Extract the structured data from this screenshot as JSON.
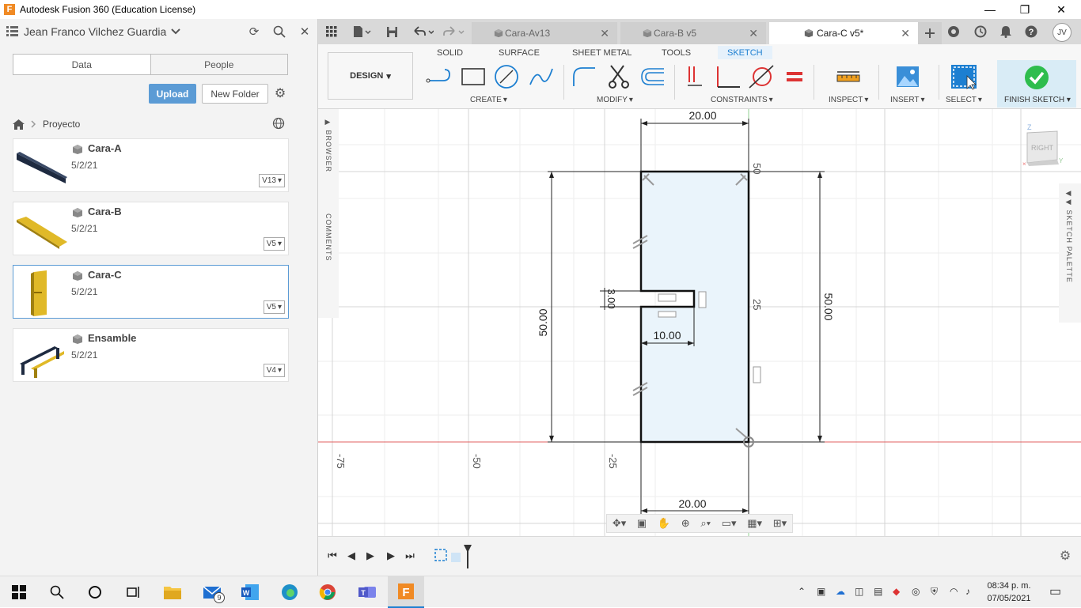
{
  "window": {
    "title": "Autodesk Fusion 360 (Education License)",
    "logo": "F",
    "min": "—",
    "max": "❐",
    "close": "✕"
  },
  "panel": {
    "user": "Jean Franco Vilchez Guardia",
    "tabs": [
      "Data",
      "People"
    ],
    "upload": "Upload",
    "new_folder": "New Folder",
    "breadcrumb": "Proyecto",
    "files": [
      {
        "name": "Cara-A",
        "date": "5/2/21",
        "version": "V13"
      },
      {
        "name": "Cara-B",
        "date": "5/2/21",
        "version": "V5"
      },
      {
        "name": "Cara-C",
        "date": "5/2/21",
        "version": "V5"
      },
      {
        "name": "Ensamble",
        "date": "5/2/21",
        "version": "V4"
      }
    ]
  },
  "tabs": {
    "docs": [
      {
        "label": "Cara-Av13"
      },
      {
        "label": "Cara-B v5"
      },
      {
        "label": "Cara-C v5*"
      }
    ],
    "user_initials": "JV"
  },
  "toolbar": {
    "design": "DESIGN",
    "workspaces": [
      "SOLID",
      "SURFACE",
      "SHEET METAL",
      "TOOLS",
      "SKETCH"
    ],
    "groups": [
      "CREATE",
      "MODIFY",
      "CONSTRAINTS",
      "INSPECT",
      "INSERT",
      "SELECT",
      "FINISH SKETCH"
    ]
  },
  "canvas": {
    "browser": "BROWSER",
    "comments": "COMMENTS",
    "palette": "SKETCH PALETTE",
    "viewcube": "RIGHT",
    "axis_z": "Z",
    "axis_y": "Y",
    "dims": {
      "top": "20.00",
      "bottom": "20.00",
      "left": "50.00",
      "right": "50.00",
      "slot_h": "3.00",
      "slot_w": "10.00"
    },
    "grid_labels": {
      "a": "50",
      "b": "25",
      "c": "-75",
      "d": "-50",
      "e": "-25"
    }
  },
  "taskbar": {
    "badge": "9",
    "time": "08:34 p. m.",
    "date": "07/05/2021"
  },
  "colors": {
    "accent": "#1d7fd1",
    "upload": "#5b9bd5",
    "finish": "#2ebd4d"
  }
}
